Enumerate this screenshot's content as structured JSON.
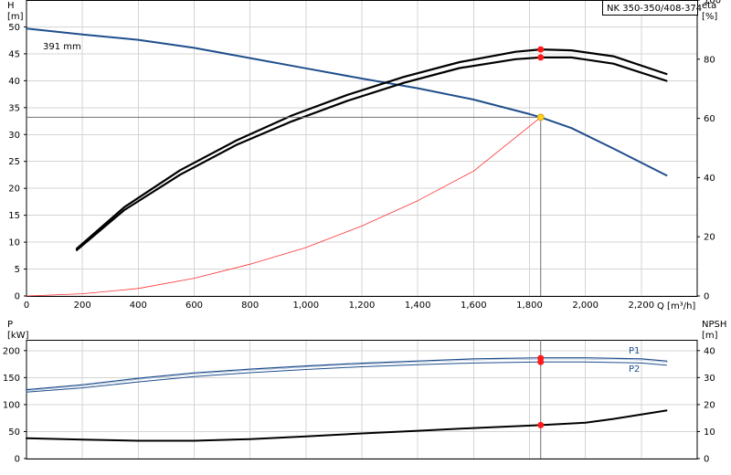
{
  "chart_data": [
    {
      "type": "line",
      "title": "NK 350-350/408-374",
      "annotation": "391 mm",
      "y_left": {
        "label_top": "H",
        "label_unit": "[m]",
        "lim": [
          0,
          55
        ],
        "ticks": [
          0,
          5,
          10,
          15,
          20,
          25,
          30,
          35,
          40,
          45,
          50
        ]
      },
      "y_right": {
        "label_top": "eta",
        "label_unit": "[%]",
        "lim": [
          0,
          100
        ],
        "ticks": [
          0,
          20,
          40,
          60,
          80,
          100
        ]
      },
      "x": {
        "label": "Q [m³/h]",
        "lim": [
          0,
          2400
        ],
        "ticks": [
          0,
          200,
          400,
          600,
          800,
          1000,
          1200,
          1400,
          1600,
          1800,
          2000,
          2200
        ],
        "tick_labels": [
          "0",
          "200",
          "400",
          "600",
          "800",
          "1,000",
          "1,200",
          "1,400",
          "1,600",
          "1,800",
          "2,000",
          "2,200"
        ]
      },
      "grid": true,
      "series": [
        {
          "id": "head",
          "axis": "left",
          "color": "#1f4e8c",
          "width": 2,
          "x": [
            0,
            200,
            400,
            600,
            800,
            1000,
            1200,
            1400,
            1600,
            1800,
            1840,
            1950,
            2100,
            2290
          ],
          "y": [
            49.7,
            48.6,
            47.6,
            46.1,
            44.2,
            42.3,
            40.4,
            38.6,
            36.5,
            33.8,
            33.2,
            31.2,
            27.4,
            22.4
          ]
        },
        {
          "id": "system",
          "axis": "left",
          "color": "#ff3030",
          "width": 0.8,
          "x": [
            0,
            200,
            400,
            600,
            800,
            1000,
            1200,
            1400,
            1600,
            1840
          ],
          "y": [
            0,
            0.4,
            1.4,
            3.3,
            5.9,
            9.0,
            13.0,
            17.7,
            23.2,
            33.2
          ]
        },
        {
          "id": "eta-1",
          "axis": "right",
          "color": "#000000",
          "width": 2.2,
          "x": [
            180,
            350,
            550,
            750,
            950,
            1150,
            1350,
            1550,
            1750,
            1840,
            1950,
            2100,
            2290
          ],
          "y": [
            15.5,
            29,
            41,
            51,
            59,
            66,
            72,
            77,
            80,
            80.6,
            80.6,
            78.5,
            72.7
          ]
        },
        {
          "id": "eta-2",
          "axis": "right",
          "color": "#000000",
          "width": 2.2,
          "x": [
            180,
            350,
            550,
            750,
            950,
            1150,
            1350,
            1550,
            1750,
            1840,
            1950,
            2100,
            2290
          ],
          "y": [
            16,
            30,
            42.5,
            52.5,
            61,
            68,
            74,
            79,
            82.5,
            83.3,
            83,
            81,
            75
          ]
        }
      ],
      "duty_point": {
        "x": 1840,
        "y": 33.2
      },
      "eta_points": [
        80.6,
        83.3
      ]
    },
    {
      "type": "line",
      "y_left": {
        "label_top": "P",
        "label_unit": "[kW]",
        "lim": [
          0,
          220
        ],
        "ticks": [
          0,
          50,
          100,
          150,
          200
        ]
      },
      "y_right": {
        "label_top": "NPSH",
        "label_unit": "[m]",
        "lim": [
          0,
          44
        ],
        "ticks": [
          0,
          10,
          20,
          30,
          40
        ]
      },
      "x": {
        "lim": [
          0,
          2400
        ],
        "ticks": [
          0,
          200,
          400,
          600,
          800,
          1000,
          1200,
          1400,
          1600,
          1800,
          2000,
          2200
        ]
      },
      "grid": true,
      "series": [
        {
          "id": "p1",
          "name": "P1",
          "axis": "left",
          "color": "#1f4e8c",
          "width": 2,
          "x": [
            0,
            200,
            400,
            600,
            800,
            1000,
            1200,
            1400,
            1600,
            1840,
            2000,
            2200,
            2290
          ],
          "y": [
            127,
            136,
            148,
            158,
            165,
            171,
            176,
            180,
            184,
            186,
            186,
            184,
            180
          ]
        },
        {
          "id": "p2",
          "name": "P2",
          "axis": "left",
          "color": "#1f4e8c",
          "width": 1,
          "x": [
            0,
            200,
            400,
            600,
            800,
            1000,
            1200,
            1400,
            1600,
            1840,
            2000,
            2200,
            2290
          ],
          "y": [
            123,
            131,
            142,
            152,
            159,
            165,
            170,
            174,
            177,
            179,
            179,
            177,
            173
          ]
        },
        {
          "id": "npsh",
          "axis": "right",
          "color": "#000000",
          "width": 2,
          "x": [
            0,
            200,
            400,
            600,
            800,
            1000,
            1200,
            1400,
            1600,
            1840,
            2000,
            2100,
            2290
          ],
          "y": [
            7.5,
            7,
            6.6,
            6.6,
            7.2,
            8.2,
            9.3,
            10.3,
            11.3,
            12.4,
            13.3,
            14.7,
            17.8
          ]
        }
      ],
      "duty_points": {
        "p1": 186,
        "p2": 179,
        "npsh": 12.4,
        "x": 1840
      }
    }
  ]
}
